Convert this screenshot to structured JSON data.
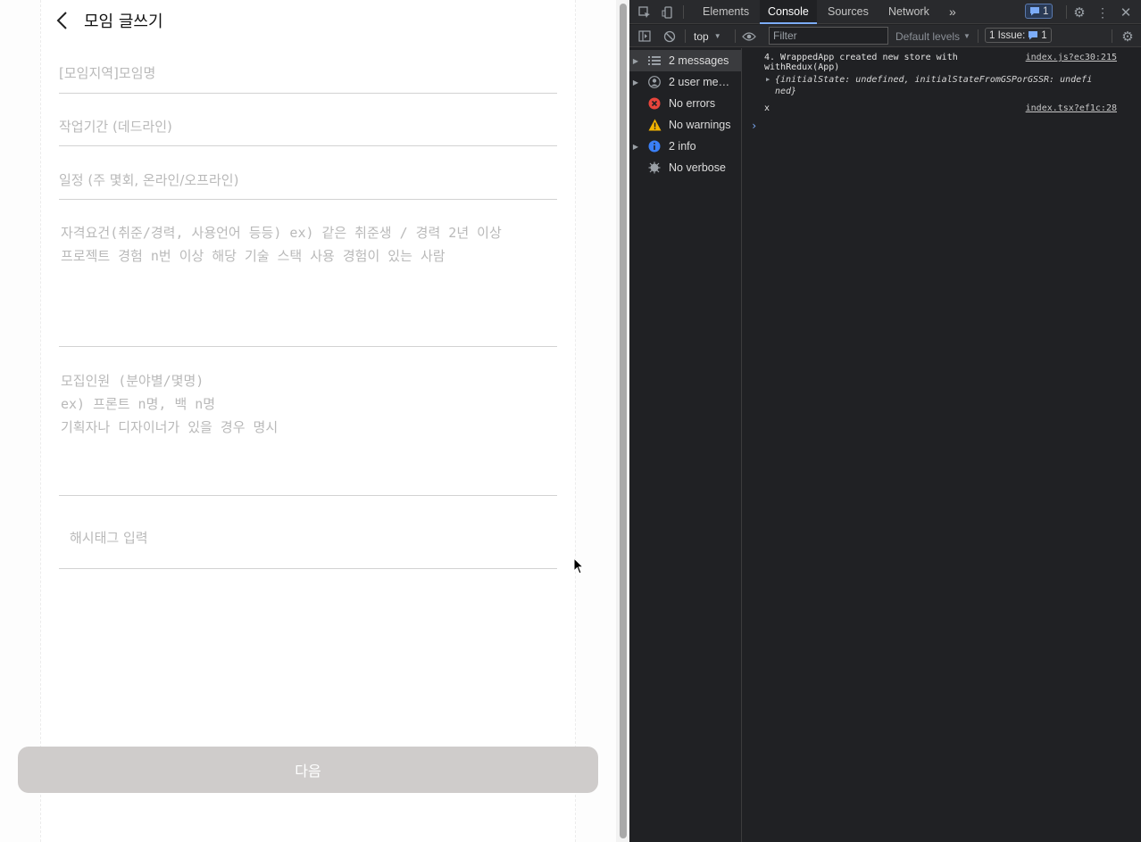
{
  "page": {
    "header": {
      "title": "모임 글쓰기",
      "back_icon": "chevron-left-icon"
    },
    "form": {
      "title_placeholder": "[모임지역]모임명",
      "period_placeholder": "작업기간 (데드라인)",
      "schedule_placeholder": "일정 (주 몇회, 온라인/오프라인)",
      "requirements_placeholder": "자격요건(취준/경력, 사용언어 등등) ex) 같은 취준생 / 경력 2년 이상\n프로젝트 경험 n번 이상 해당 기술 스택 사용 경험이 있는 사람",
      "recruit_placeholder": "모집인원 (분야별/몇명)\nex) 프론트 n명, 백 n명\n기획자나 디자이너가 있을 경우 명시",
      "hashtag_placeholder": "해시태그 입력"
    },
    "next_button": "다음"
  },
  "devtools": {
    "tabs": [
      "Elements",
      "Console",
      "Sources",
      "Network"
    ],
    "active_tab": "Console",
    "more_tabs": "»",
    "issues_badge_count": "1",
    "context": "top",
    "filter_placeholder": "Filter",
    "levels": "Default levels",
    "issues_label": "1 Issue:",
    "issues_count": "1",
    "sidebar": [
      {
        "label": "2 messages",
        "icon": "list-icon",
        "expandable": true
      },
      {
        "label": "2 user mes…",
        "icon": "user-icon",
        "expandable": true
      },
      {
        "label": "No errors",
        "icon": "error-icon",
        "expandable": false
      },
      {
        "label": "No warnings",
        "icon": "warning-icon",
        "expandable": false
      },
      {
        "label": "2 info",
        "icon": "info-icon",
        "expandable": true
      },
      {
        "label": "No verbose",
        "icon": "bug-icon",
        "expandable": false
      }
    ],
    "messages": [
      {
        "line1": "4. WrappedApp created new store with",
        "line2": "withRedux(App)",
        "source": "index.js?ec30:215",
        "object_line1": "{initialState: undefined, initialStateFromGSPorGSSR: undefi",
        "object_line2": "ned}"
      },
      {
        "text": "x",
        "source": "index.tsx?ef1c:28"
      }
    ],
    "prompt": "›"
  },
  "colors": {
    "button_disabled": "#cfcccb",
    "devtools_bg": "#202124",
    "accent": "#7cacf8",
    "error": "#e8453c",
    "warning": "#f2b300",
    "info": "#3a7ff6"
  }
}
